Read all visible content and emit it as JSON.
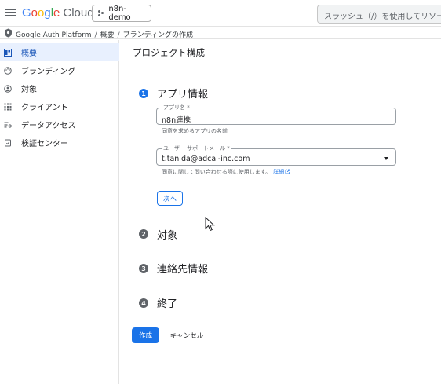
{
  "header": {
    "logo_google": [
      "G",
      "o",
      "o",
      "g",
      "l",
      "e"
    ],
    "logo_cloud": "Cloud",
    "project_name": "n8n-demo",
    "search_placeholder": "スラッシュ（/）を使用してリソース"
  },
  "breadcrumb": {
    "items": [
      "Google Auth Platform",
      "概要",
      "ブランディングの作成"
    ],
    "separator": "/"
  },
  "sidebar": {
    "items": [
      {
        "label": "概要",
        "icon": "dashboard-icon",
        "active": true
      },
      {
        "label": "ブランディング",
        "icon": "palette-icon",
        "active": false
      },
      {
        "label": "対象",
        "icon": "person-icon",
        "active": false
      },
      {
        "label": "クライアント",
        "icon": "grid-icon",
        "active": false
      },
      {
        "label": "データアクセス",
        "icon": "data-access-icon",
        "active": false
      },
      {
        "label": "検証センター",
        "icon": "verify-icon",
        "active": false
      }
    ]
  },
  "main": {
    "title": "プロジェクト構成",
    "steps": [
      {
        "number": "1",
        "label": "アプリ情報",
        "state": "active"
      },
      {
        "number": "2",
        "label": "対象",
        "state": "inactive"
      },
      {
        "number": "3",
        "label": "連絡先情報",
        "state": "inactive"
      },
      {
        "number": "4",
        "label": "終了",
        "state": "inactive"
      }
    ],
    "app_name_field": {
      "label": "アプリ名 *",
      "value": "n8n連携",
      "hint": "同意を求めるアプリの名前"
    },
    "support_email_field": {
      "label": "ユーザー サポートメール *",
      "value": "t.tanida@adcal-inc.com",
      "hint": "同意に関して問い合わせる際に使用します。",
      "hint_link": "詳細"
    },
    "next_label": "次へ",
    "create_label": "作成",
    "cancel_label": "キャンセル"
  },
  "colors": {
    "accent": "#1a73e8",
    "active_nav_bg": "#e8f0fe"
  }
}
